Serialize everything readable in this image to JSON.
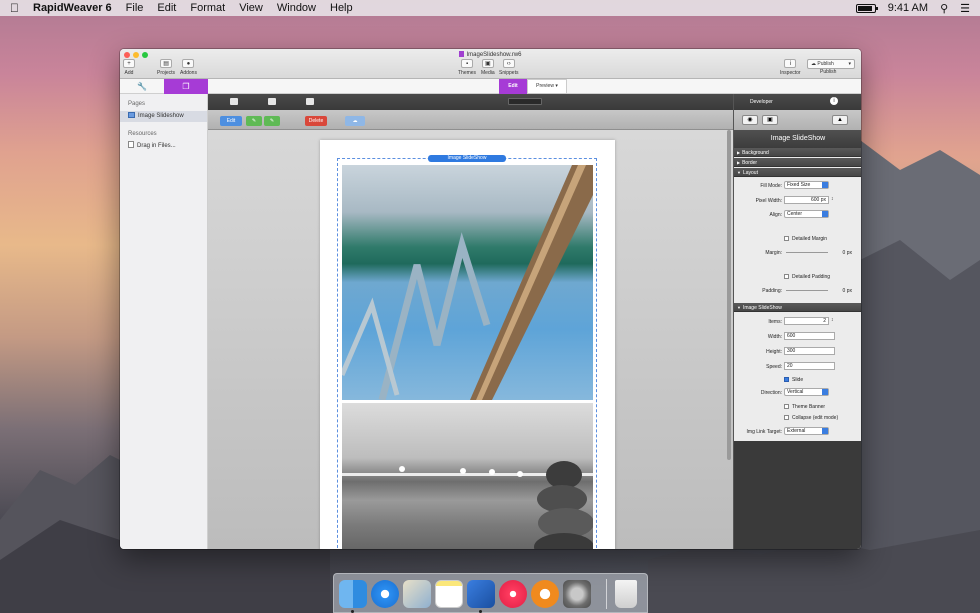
{
  "menubar": {
    "app_name": "RapidWeaver 6",
    "items": [
      "File",
      "Edit",
      "Format",
      "View",
      "Window",
      "Help"
    ],
    "clock": "9:41 AM",
    "battery_level": 0.9
  },
  "window": {
    "document_title": "ImageSlideshow.rw6",
    "toolbar": {
      "add": "Add",
      "projects": "Projects",
      "addons": "Addons",
      "themes": "Themes",
      "media": "Media",
      "snippets": "Snippets",
      "inspector": "Inspector",
      "publish_button": "Publish",
      "publish_label": "Publish"
    },
    "modes": {
      "edit": "Edit",
      "preview": "Preview"
    }
  },
  "sidebar": {
    "pages_heading": "Pages",
    "pages": [
      {
        "label": "Image Slideshow"
      }
    ],
    "resources_heading": "Resources",
    "resources": [
      {
        "label": "Drag in Files..."
      }
    ]
  },
  "editor": {
    "edit_button": "Edit",
    "delete_button": "Delete",
    "slideshow_label": "Image SlideShow"
  },
  "inspector": {
    "developer_label": "Developer",
    "title": "Image SlideShow",
    "sections": {
      "background": "Background",
      "border": "Border",
      "layout": "Layout",
      "image_slideshow": "Image SlideShow"
    },
    "layout": {
      "fill_mode_label": "Fill Mode:",
      "fill_mode_value": "Fixed Size",
      "pixel_width_label": "Pixel Width:",
      "pixel_width_value": "600 px",
      "align_label": "Align:",
      "align_value": "Center",
      "detailed_margin": "Detailed Margin",
      "margin_label": "Margin:",
      "margin_value": "0 px",
      "detailed_padding": "Detailed Padding",
      "padding_label": "Padding:",
      "padding_value": "0 px"
    },
    "slideshow": {
      "items_label": "Items:",
      "items_value": "2",
      "width_label": "Width:",
      "width_value": "600",
      "height_label": "Height:",
      "height_value": "300",
      "speed_label": "Speed:",
      "speed_value": "20",
      "slide_label": "Slide",
      "direction_label": "Direction:",
      "direction_value": "Vertical",
      "theme_banner": "Theme Banner",
      "collapse": "Collapse (edit mode)",
      "link_target_label": "Img Link Target:",
      "link_target_value": "External"
    }
  },
  "colors": {
    "accent_purple": "#a63bd6",
    "select_blue": "#3a7de0"
  }
}
